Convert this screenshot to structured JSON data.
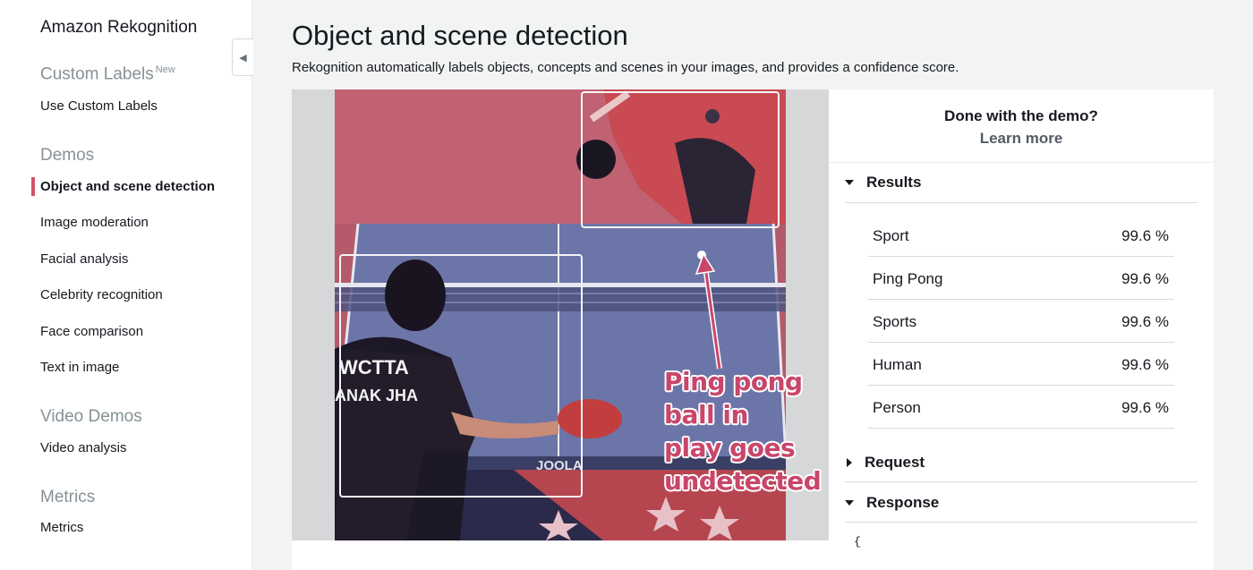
{
  "sidebar": {
    "title": "Amazon Rekognition",
    "custom_labels": {
      "heading": "Custom Labels",
      "badge": "New",
      "items": [
        "Use Custom Labels"
      ]
    },
    "demos": {
      "heading": "Demos",
      "items": [
        "Object and scene detection",
        "Image moderation",
        "Facial analysis",
        "Celebrity recognition",
        "Face comparison",
        "Text in image"
      ],
      "active": "Object and scene detection"
    },
    "video_demos": {
      "heading": "Video Demos",
      "items": [
        "Video analysis"
      ]
    },
    "metrics": {
      "heading": "Metrics",
      "items": [
        "Metrics"
      ]
    }
  },
  "main": {
    "title": "Object and scene detection",
    "description": "Rekognition automatically labels objects, concepts and scenes in your images, and provides a confidence score.",
    "annotation_lines": [
      "Ping pong",
      "ball in",
      "play goes",
      "undetected"
    ],
    "photo_jersey_text": [
      "WCTTA",
      "ANAK JHA"
    ],
    "photo_table_brand": "JOOLA"
  },
  "panel": {
    "demo_question": "Done with the demo?",
    "learn_more": "Learn more",
    "results_heading": "Results",
    "results": [
      {
        "label": "Sport",
        "value": "99.6 %"
      },
      {
        "label": "Ping Pong",
        "value": "99.6 %"
      },
      {
        "label": "Sports",
        "value": "99.6 %"
      },
      {
        "label": "Human",
        "value": "99.6 %"
      },
      {
        "label": "Person",
        "value": "99.6 %"
      }
    ],
    "request_heading": "Request",
    "response_heading": "Response",
    "response_preview": "{"
  },
  "colors": {
    "accent_active": "#d4516a",
    "annotation": "#c9466a",
    "bbox": "#f4f4f8"
  }
}
